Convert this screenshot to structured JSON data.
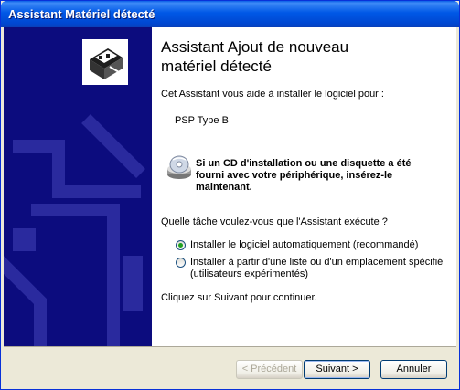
{
  "window": {
    "title": "Assistant Matériel détecté"
  },
  "content": {
    "heading_line1": "Assistant Ajout de nouveau",
    "heading_line2": "matériel détecté",
    "intro": "Cet Assistant vous aide à installer le logiciel pour :",
    "device_name": "PSP Type B",
    "cd_notice_line1": "Si un CD d'installation ou une disquette a été",
    "cd_notice_line2": "fourni avec votre périphérique, insérez-le",
    "cd_notice_line3": "maintenant.",
    "question": "Quelle tâche voulez-vous que l'Assistant exécute ?",
    "options": [
      {
        "label": "Installer le logiciel automatiquement (recommandé)",
        "selected": true
      },
      {
        "label": "Installer à partir d'une liste ou d'un emplacement spécifié",
        "label_line2": "(utilisateurs expérimentés)",
        "selected": false
      }
    ],
    "continue_hint": "Cliquez sur Suivant pour continuer."
  },
  "buttons": {
    "back": "< Précédent",
    "next": "Suivant >",
    "cancel": "Annuler"
  },
  "icons": {
    "hardware": "hardware-card-icon",
    "cd": "cd-icon"
  }
}
